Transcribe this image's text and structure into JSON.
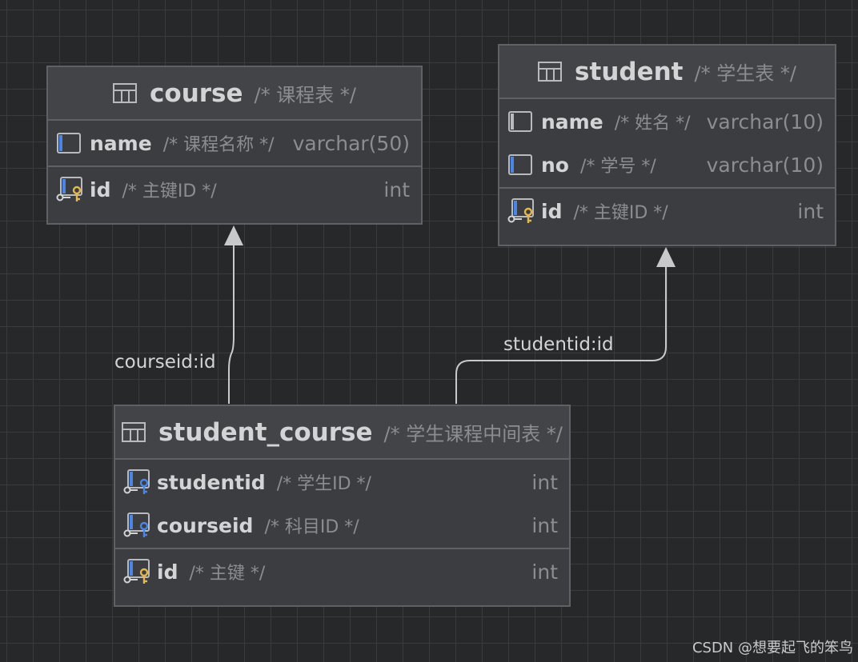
{
  "tables": {
    "course": {
      "name": "course",
      "comment": "/* 课程表 */",
      "columns": [
        {
          "name": "name",
          "comment": "/* 课程名称 */",
          "type": "varchar(50)",
          "icon": "column-icon"
        }
      ],
      "keys": [
        {
          "name": "id",
          "comment": "/* 主键ID */",
          "type": "int",
          "icon": "primary-key-icon"
        }
      ]
    },
    "student": {
      "name": "student",
      "comment": "/* 学生表 */",
      "columns": [
        {
          "name": "name",
          "comment": "/* 姓名 */",
          "type": "varchar(10)",
          "icon": "column-icon"
        },
        {
          "name": "no",
          "comment": "/* 学号 */",
          "type": "varchar(10)",
          "icon": "column-icon"
        }
      ],
      "keys": [
        {
          "name": "id",
          "comment": "/* 主键ID */",
          "type": "int",
          "icon": "primary-key-icon"
        }
      ]
    },
    "student_course": {
      "name": "student_course",
      "comment": "/* 学生课程中间表 */",
      "columns": [
        {
          "name": "studentid",
          "comment": "/* 学生ID */",
          "type": "int",
          "icon": "foreign-key-icon"
        },
        {
          "name": "courseid",
          "comment": "/* 科目ID */",
          "type": "int",
          "icon": "foreign-key-icon"
        }
      ],
      "keys": [
        {
          "name": "id",
          "comment": "/* 主键 */",
          "type": "int",
          "icon": "primary-key-icon"
        }
      ]
    }
  },
  "relations": {
    "course_rel": {
      "label": "courseid:id"
    },
    "student_rel": {
      "label": "studentid:id"
    }
  },
  "watermark": "CSDN @想要起飞的笨鸟",
  "colors": {
    "background": "#27282a",
    "accent_blue": "#4a86e8",
    "key_gold": "#e6b84c",
    "line": "#c8c9cb"
  }
}
